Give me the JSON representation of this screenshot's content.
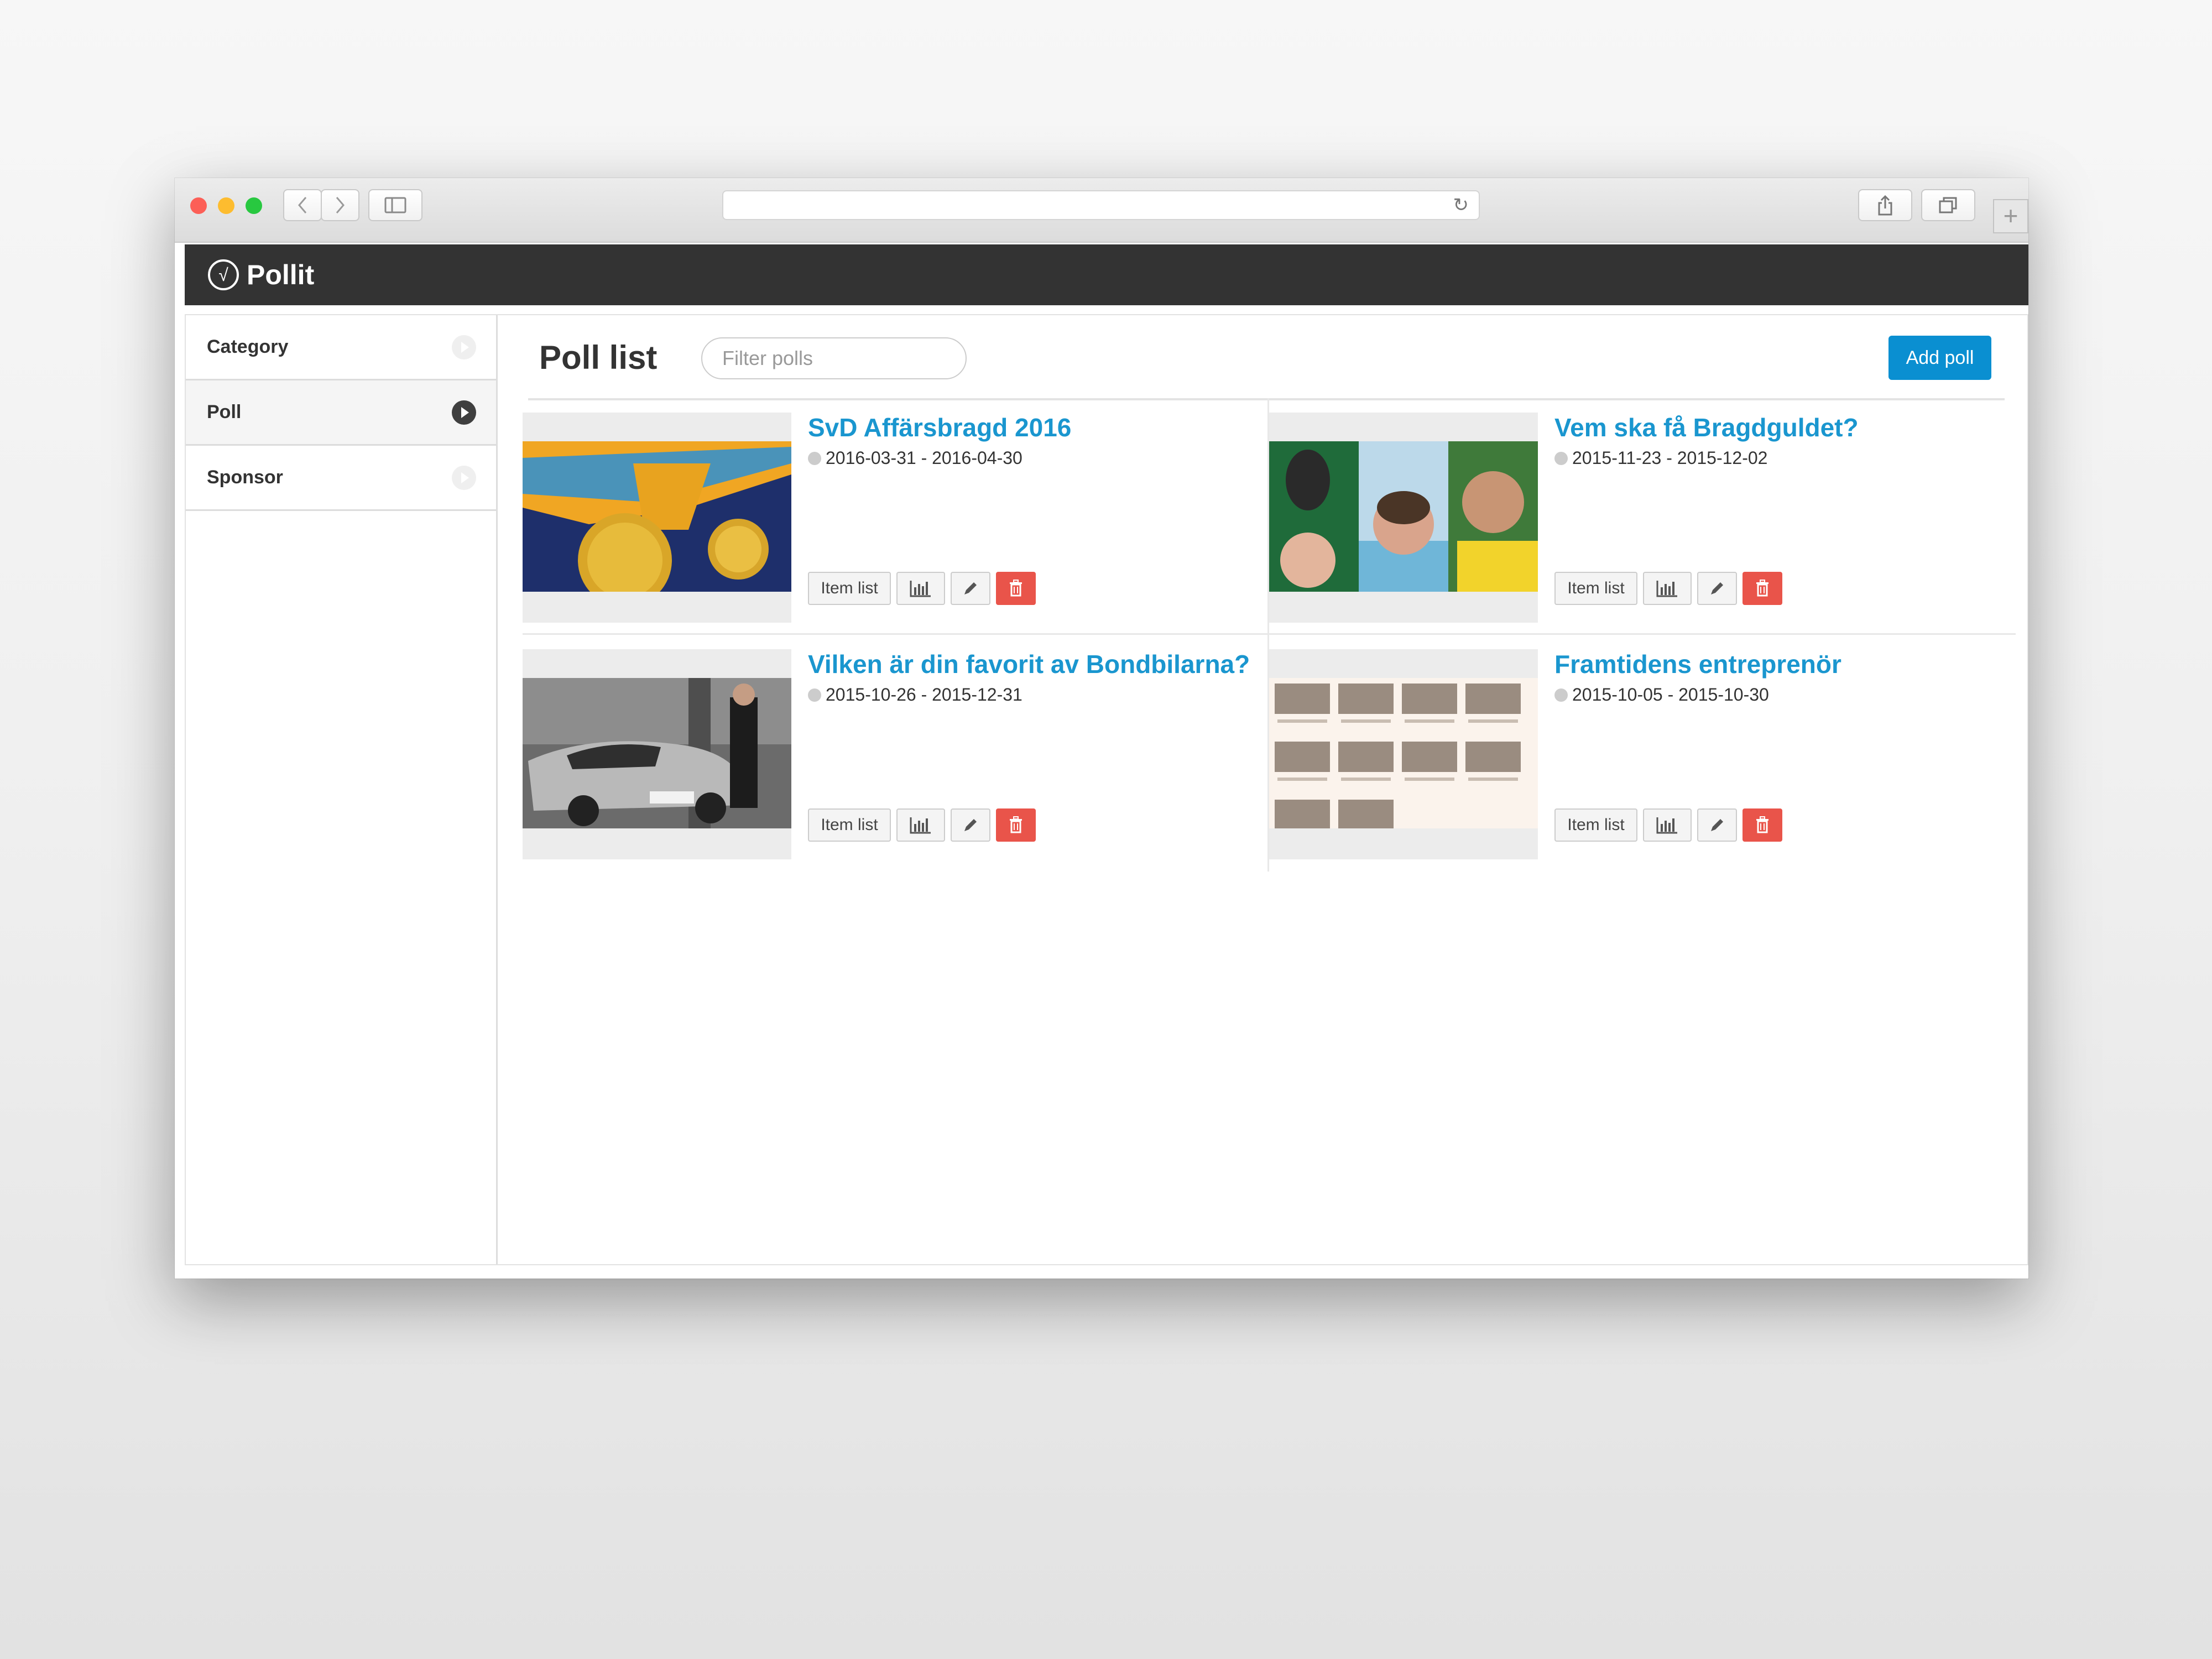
{
  "app": {
    "name": "Pollit"
  },
  "sidebar": {
    "items": [
      {
        "label": "Category",
        "active": false
      },
      {
        "label": "Poll",
        "active": true
      },
      {
        "label": "Sponsor",
        "active": false
      }
    ]
  },
  "main": {
    "title": "Poll list",
    "filter_placeholder": "Filter polls",
    "add_button": "Add poll"
  },
  "polls": [
    {
      "title": "SvD Affärsbragd 2016",
      "dates": "2016-03-31 - 2016-04-30",
      "item_list_label": "Item list"
    },
    {
      "title": "Vem ska få Bragdguldet?",
      "dates": "2015-11-23 - 2015-12-02",
      "item_list_label": "Item list"
    },
    {
      "title": "Vilken är din favorit av Bondbilarna?",
      "dates": "2015-10-26 - 2015-12-31",
      "item_list_label": "Item list"
    },
    {
      "title": "Framtidens entreprenör",
      "dates": "2015-10-05 - 2015-10-30",
      "item_list_label": "Item list"
    }
  ],
  "colors": {
    "accent": "#1a96cf",
    "add_button": "#0a8fd1",
    "delete": "#e9544a",
    "appbar": "#333333"
  },
  "icons": {
    "logo": "pollit-logo-icon",
    "stats": "bar-chart-icon",
    "edit": "pencil-icon",
    "delete": "trash-icon",
    "nav": "play-arrow-icon"
  }
}
